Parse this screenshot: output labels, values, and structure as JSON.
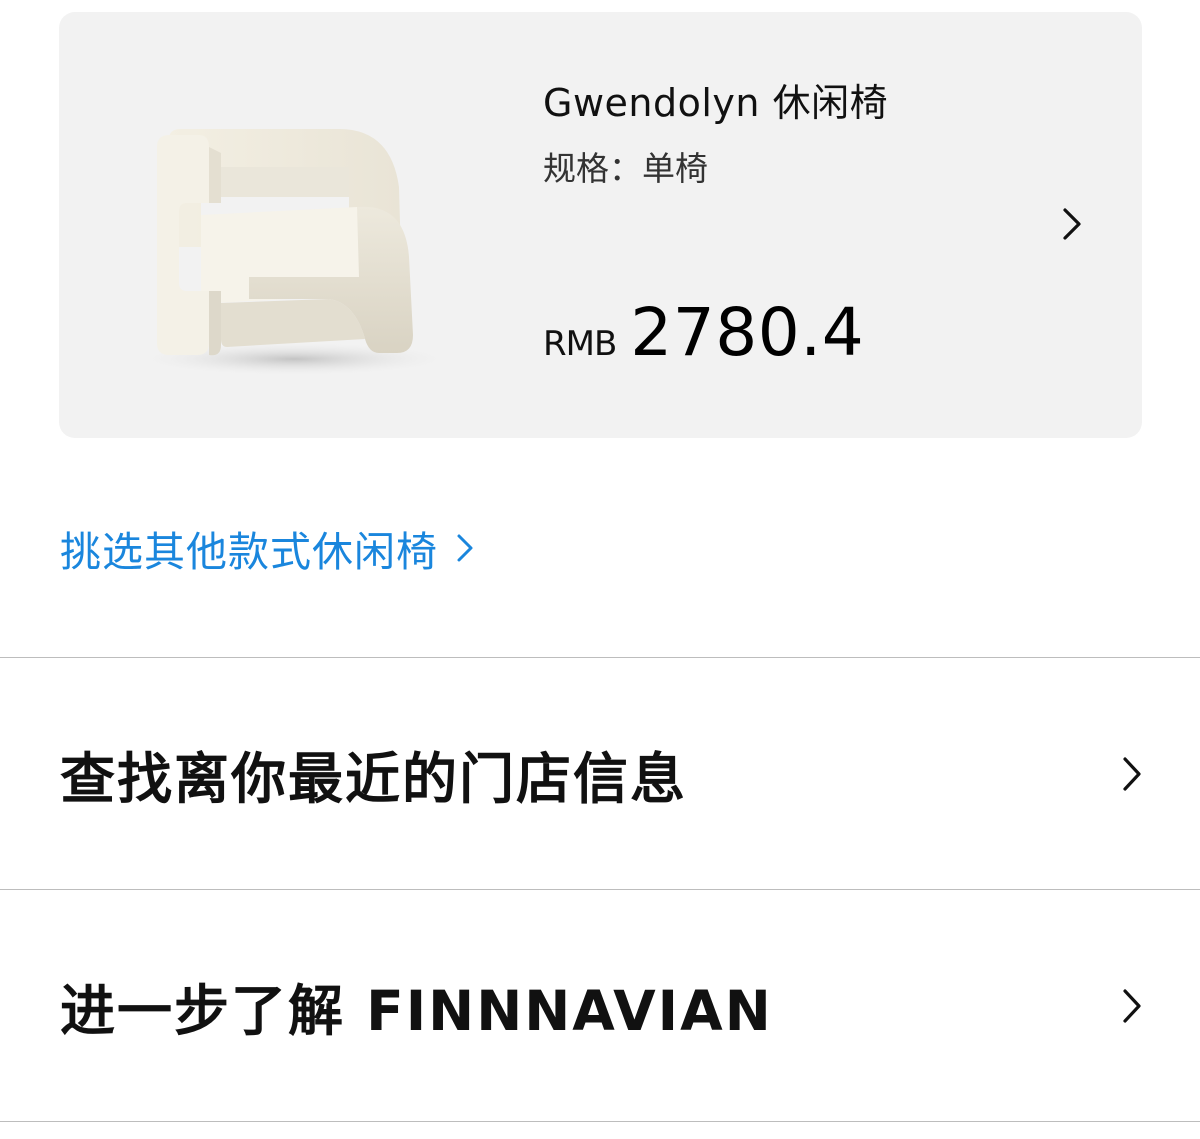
{
  "product": {
    "name": "Gwendolyn 休闲椅",
    "spec": "规格：单椅",
    "currency": "RMB",
    "price": "2780.4",
    "image_icon": "armchair-image",
    "chevron_icon": "chevron-right-icon"
  },
  "browse_link": {
    "label": "挑选其他款式休闲椅",
    "color": "#1a86dd"
  },
  "rows": [
    {
      "label": "查找离你最近的门店信息"
    },
    {
      "label": "进一步了解 FINNNAVIAN"
    }
  ]
}
